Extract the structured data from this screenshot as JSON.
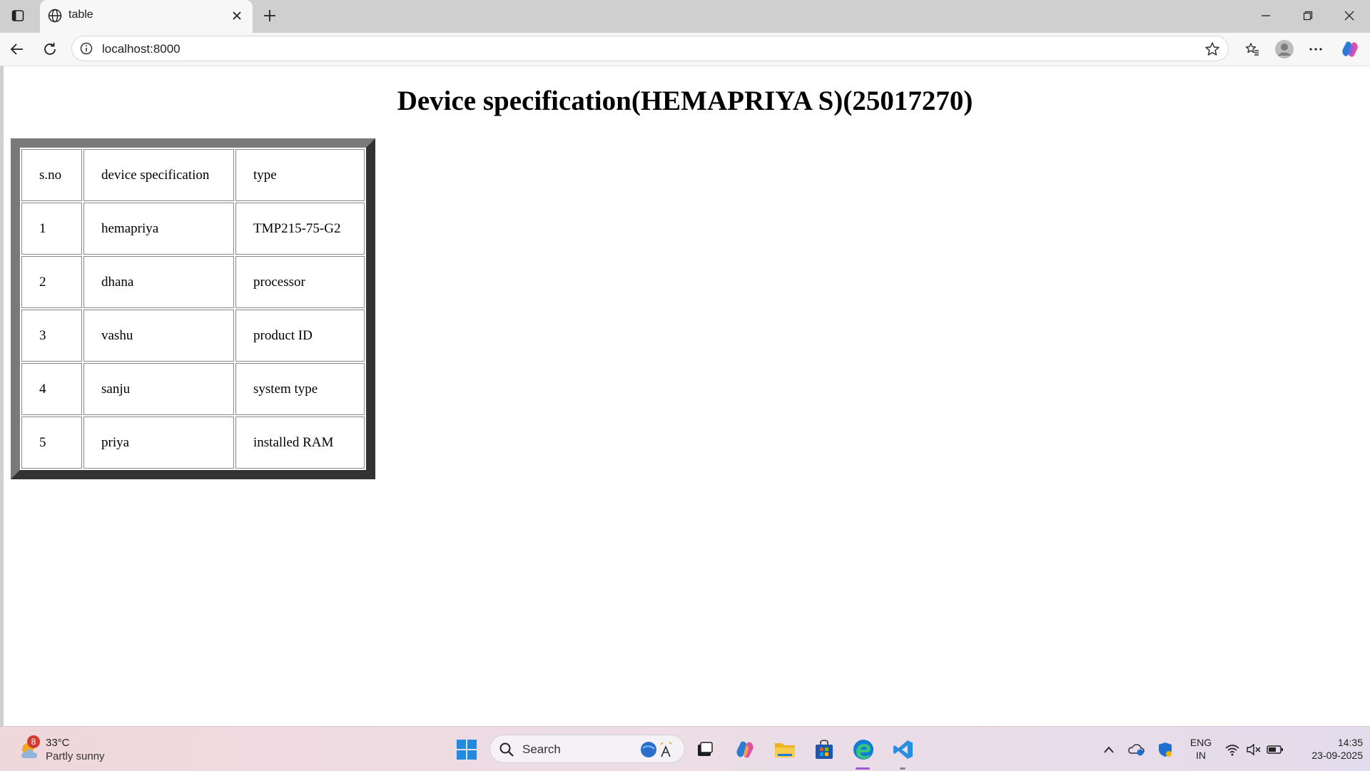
{
  "browser": {
    "tab_title": "table",
    "url": "localhost:8000"
  },
  "page": {
    "heading": "Device specification(HEMAPRIYA S)(25017270)",
    "table": {
      "header": [
        "s.no",
        "device specification",
        "type"
      ],
      "rows": [
        [
          "1",
          "hemapriya",
          "TMP215-75-G2"
        ],
        [
          "2",
          "dhana",
          "processor"
        ],
        [
          "3",
          "vashu",
          "product ID"
        ],
        [
          "4",
          "sanju",
          "system type"
        ],
        [
          "5",
          "priya",
          "installed RAM"
        ]
      ]
    }
  },
  "taskbar": {
    "weather": {
      "badge": "8",
      "temp": "33°C",
      "desc": "Partly sunny"
    },
    "search_placeholder": "Search",
    "lang_line1": "ENG",
    "lang_line2": "IN",
    "time": "14:35",
    "date": "23-09-2025"
  },
  "icons": {
    "tab_actions": "tab-actions-icon",
    "site": "globe-icon",
    "close": "close-icon",
    "new_tab": "plus-icon",
    "back": "back-arrow-icon",
    "refresh": "refresh-icon",
    "favorite": "star-icon",
    "favorites": "favorites-icon",
    "profile": "profile-icon",
    "more": "more-icon",
    "copilot": "copilot-icon"
  },
  "colors": {
    "table_border_light": "#7a7a7a",
    "table_border_dark": "#333333",
    "edge_blue": "#0f7cd8",
    "vscode_blue": "#2a8ee0"
  }
}
